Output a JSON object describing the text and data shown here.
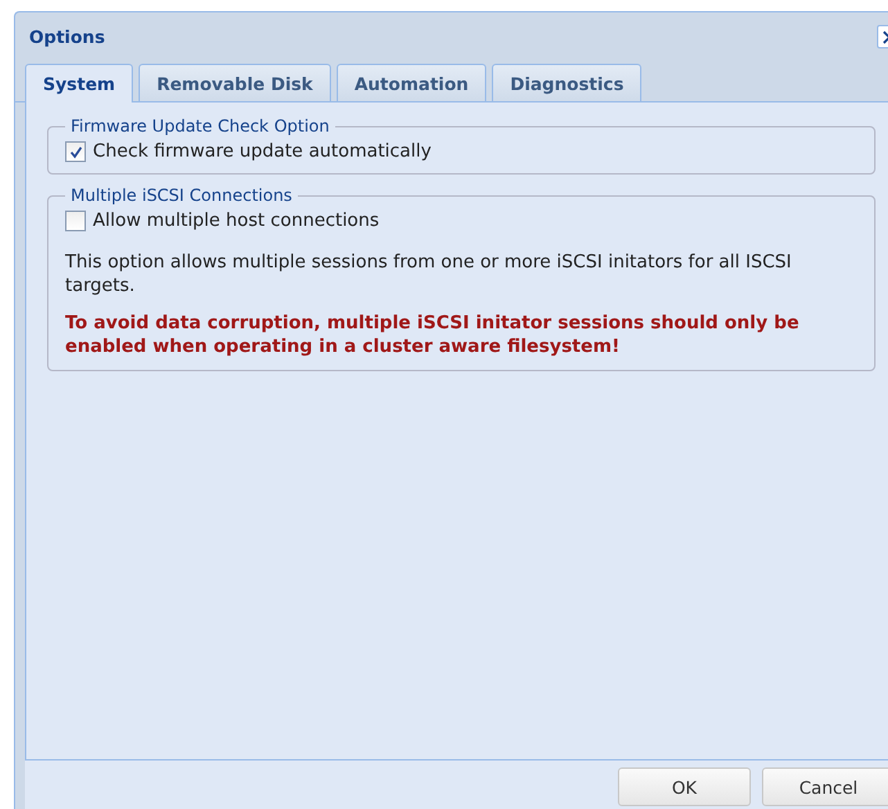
{
  "window": {
    "title": "Options"
  },
  "tabs": [
    {
      "label": "System",
      "selected": true
    },
    {
      "label": "Removable Disk",
      "selected": false
    },
    {
      "label": "Automation",
      "selected": false
    },
    {
      "label": "Diagnostics",
      "selected": false
    }
  ],
  "sections": [
    {
      "legend": "Firmware Update Check Option",
      "checkbox": {
        "label": "Check firmware update automatically",
        "checked": true
      }
    },
    {
      "legend": "Multiple iSCSI Connections",
      "checkbox": {
        "label": "Allow multiple host connections",
        "checked": false
      },
      "paragraphs": [
        {
          "kind": "info",
          "text": "This option allows multiple sessions from one or more iSCSI initators for all ISCSI targets."
        },
        {
          "kind": "warning",
          "text": "To avoid data corruption, multiple iSCSI initator sessions should only be enabled when operating in a cluster aware filesystem!"
        }
      ]
    }
  ],
  "buttons": [
    "OK",
    "Cancel"
  ]
}
